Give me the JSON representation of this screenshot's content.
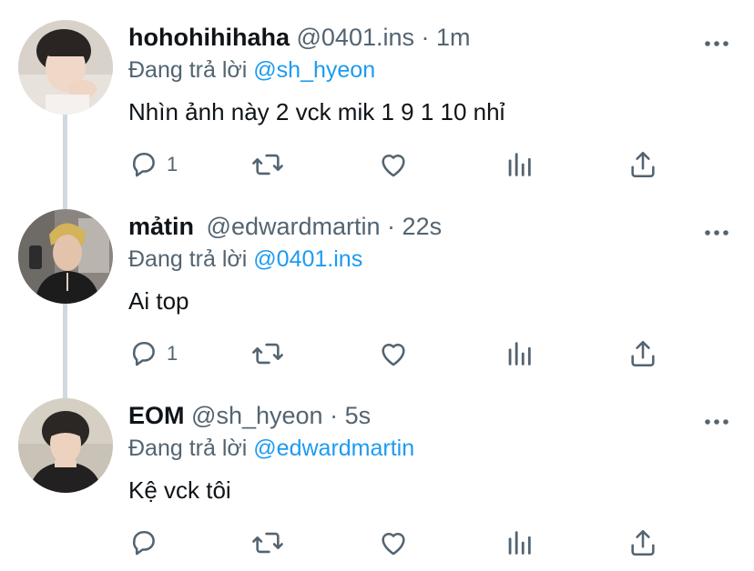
{
  "tweets": [
    {
      "display_name": "hohohihihaha",
      "handle": "@0401.ins",
      "time": "1m",
      "reply_prefix": "Đang trả lời",
      "reply_mention": "@sh_hyeon",
      "text": "Nhìn ảnh này 2 vck mik 1 9 1 10 nhỉ",
      "reply_count": "1",
      "icons": [
        "reply-icon",
        "retweet-icon",
        "like-icon",
        "analytics-icon",
        "share-icon",
        "more-icon"
      ]
    },
    {
      "display_name": "mảtin",
      "handle": "@edwardmartin",
      "time": "22s",
      "reply_prefix": "Đang trả lời",
      "reply_mention": "@0401.ins",
      "text": "Ai top",
      "reply_count": "1",
      "icons": [
        "reply-icon",
        "retweet-icon",
        "like-icon",
        "analytics-icon",
        "share-icon",
        "more-icon"
      ]
    },
    {
      "display_name": "EOM",
      "handle": "@sh_hyeon",
      "time": "5s",
      "reply_prefix": "Đang trả lời",
      "reply_mention": "@edwardmartin",
      "text": "Kệ vck tôi",
      "reply_count": "",
      "icons": [
        "reply-icon",
        "retweet-icon",
        "like-icon",
        "analytics-icon",
        "share-icon",
        "more-icon"
      ]
    }
  ],
  "colors": {
    "text": "#0f1419",
    "secondary": "#536471",
    "link": "#1d9bf0",
    "thread_line": "#cfd9de"
  }
}
